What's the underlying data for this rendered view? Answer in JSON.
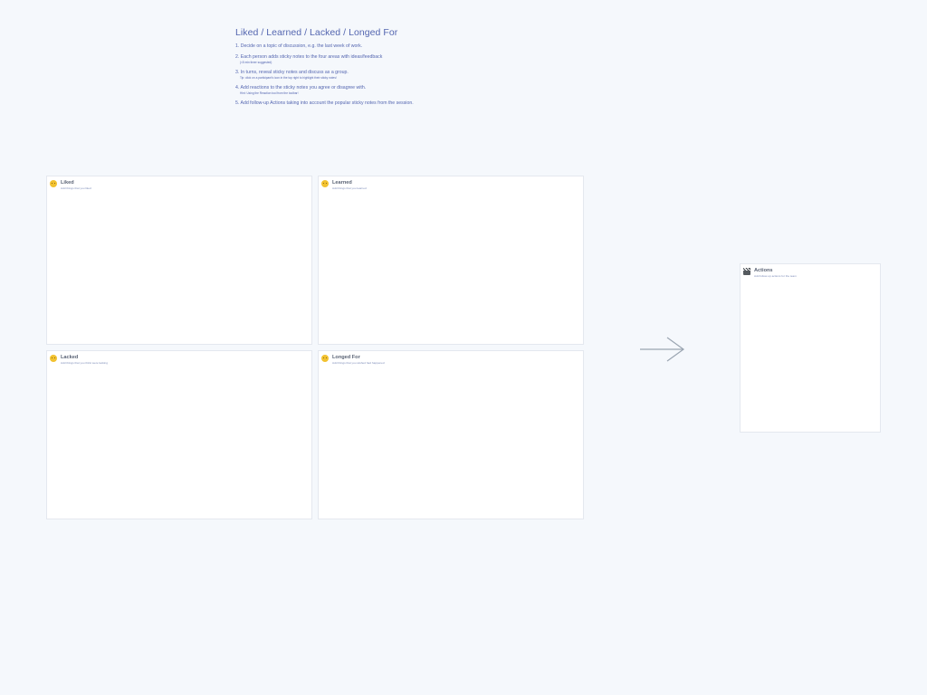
{
  "instructions": {
    "title": "Liked / Learned / Lacked / Longed For",
    "steps": [
      {
        "text": "1. Decide on a topic of discussion, e.g. the last week of work.",
        "hint": ""
      },
      {
        "text": "2. Each person adds sticky notes to the four areas with ideas/feedback",
        "hint": "(<5 min timer suggested)"
      },
      {
        "text": "3. In turns, reveal sticky notes and discuss as a group.",
        "hint": "Tip: click on a participant's icon in the top right to highlight their sticky notes!"
      },
      {
        "text": "4. Add reactions to the sticky notes you agree or disagree with.",
        "hint": "Hint: Using the Reaction tool from the toolbar!"
      },
      {
        "text": "5. Add follow-up Actions taking into account the popular sticky notes from the session.",
        "hint": ""
      }
    ]
  },
  "boards": {
    "liked": {
      "title": "Liked",
      "subtitle": "Add things that you liked",
      "icon": "smiling-face-icon"
    },
    "learned": {
      "title": "Learned",
      "subtitle": "Add things that you learned",
      "icon": "monocle-face-icon"
    },
    "lacked": {
      "title": "Lacked",
      "subtitle": "Add things that you think were lacking",
      "icon": "disappointed-face-icon"
    },
    "longed": {
      "title": "Longed For",
      "subtitle": "Add things that you wished had happened",
      "icon": "thinking-face-icon"
    },
    "actions": {
      "title": "Actions",
      "subtitle": "Add follow-up actions for the team",
      "icon": "clapper-board-icon"
    }
  },
  "colors": {
    "background": "#f5f8fc",
    "instruction_text": "#5466b0",
    "board_border": "#e4e8ef",
    "arrow": "#9aa5b1"
  }
}
